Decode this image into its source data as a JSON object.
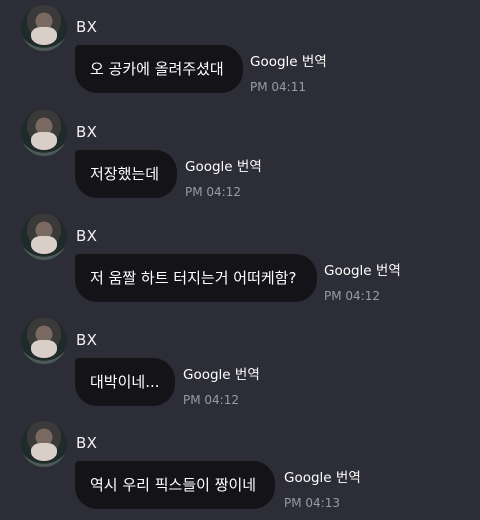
{
  "messages": [
    {
      "sender": "BX",
      "text": "오 공카에 올려주셨대",
      "translate": "Google 번역",
      "time": "PM 04:11"
    },
    {
      "sender": "BX",
      "text": "저장했는데",
      "translate": "Google 번역",
      "time": "PM 04:12"
    },
    {
      "sender": "BX",
      "text": "저 움짤 하트 터지는거 어떠케함?",
      "translate": "Google 번역",
      "time": "PM 04:12"
    },
    {
      "sender": "BX",
      "text": "대박이네...",
      "translate": "Google 번역",
      "time": "PM 04:12"
    },
    {
      "sender": "BX",
      "text": "역시 우리 픽스들이 짱이네",
      "translate": "Google 번역",
      "time": "PM 04:13"
    }
  ]
}
